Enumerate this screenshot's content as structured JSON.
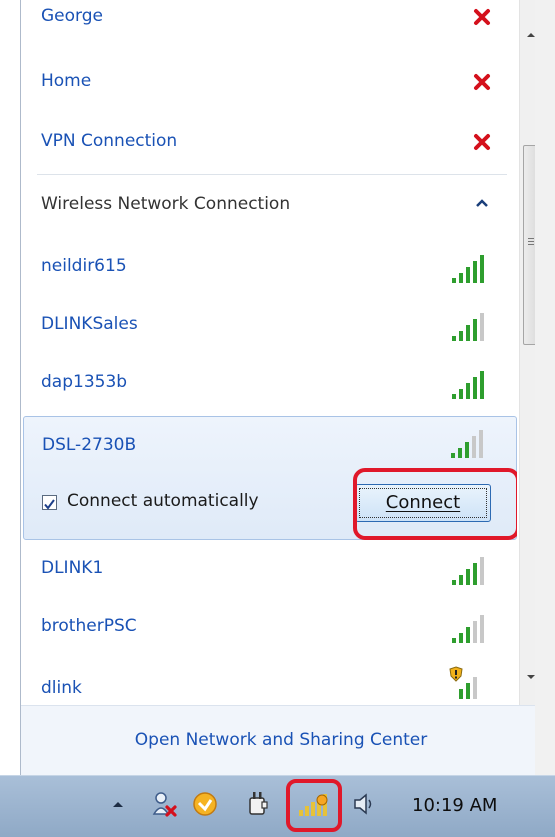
{
  "networks_top": [
    {
      "name": "George",
      "action": "disconnect-x"
    },
    {
      "name": "Home",
      "action": "disconnect-x"
    },
    {
      "name": "VPN Connection",
      "action": "disconnect-x"
    }
  ],
  "wireless_section": {
    "title": "Wireless Network Connection"
  },
  "networks": [
    {
      "name": "neildir615",
      "signal": 5
    },
    {
      "name": "DLINKSales",
      "signal": 4
    },
    {
      "name": "dap1353b",
      "signal": 5
    }
  ],
  "selected_network": {
    "name": "DSL-2730B",
    "signal": 3,
    "connect_automatically_label": "Connect automatically",
    "connect_automatically_checked": true,
    "connect_button_label": "Connect"
  },
  "networks_bottom": [
    {
      "name": "DLINK1",
      "signal": 4
    },
    {
      "name": "brotherPSC",
      "signal": 3
    },
    {
      "name": "dlink",
      "signal": 3,
      "secured_warning": true
    }
  ],
  "footer": {
    "link_label": "Open Network and Sharing Center"
  },
  "taskbar": {
    "clock": "10:19 AM"
  },
  "colors": {
    "link_blue": "#1a52b5",
    "highlight_red": "#e0182a",
    "signal_green": "#2e9e2e",
    "disconnect_red": "#d4101c"
  }
}
